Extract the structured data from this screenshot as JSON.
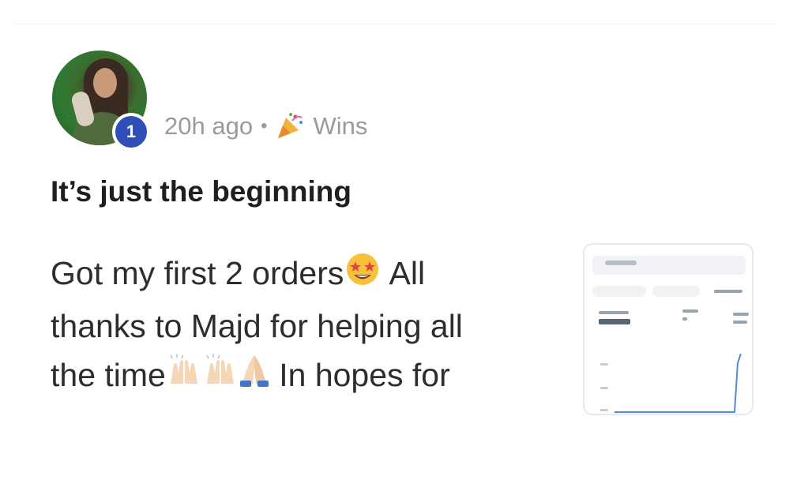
{
  "post": {
    "author_level": "1",
    "time_ago": "20h ago",
    "separator": "•",
    "category_icon": "party-popper-icon",
    "category": "Wins",
    "title": "It’s just the beginning",
    "body": {
      "line1_a": "Got my first 2 orders",
      "line1_b": " All",
      "line2": "thanks to Majd for helping all",
      "line3_a": "the time",
      "line3_b": " In hopes for"
    },
    "attachment_icon": "dashboard-screenshot-thumbnail"
  },
  "colors": {
    "badge": "#2f4fb7",
    "meta_text": "#9a9a9a",
    "title_text": "#1f1f1f",
    "body_text": "#2d2d2d",
    "chart_line": "#4a90d9"
  }
}
